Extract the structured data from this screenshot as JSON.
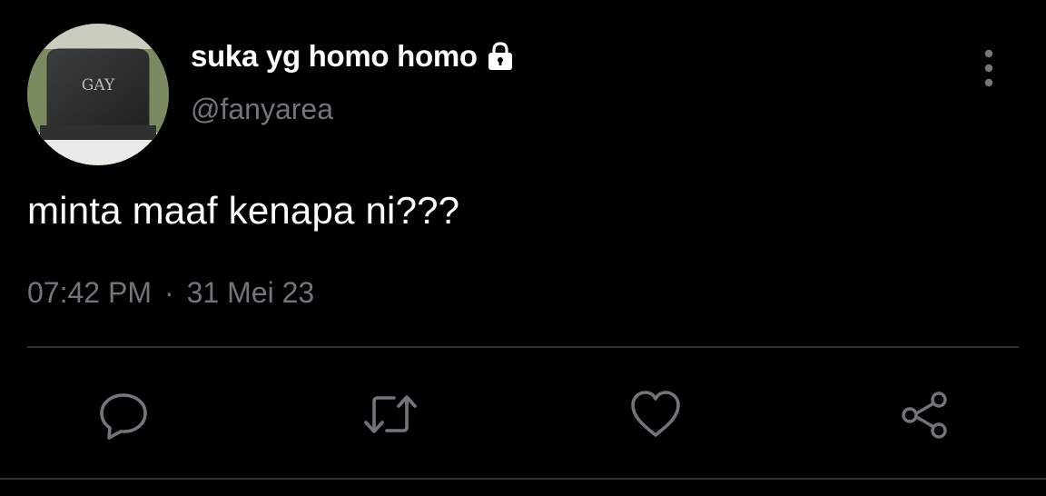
{
  "tweet": {
    "display_name": "suka yg homo homo",
    "handle": "@fanyarea",
    "protected_icon": "lock-icon",
    "avatar": {
      "description_icon": "gravestone-avatar",
      "engraving": "GAY"
    },
    "text": "minta maaf kenapa ni???",
    "time": "07:42 PM",
    "separator": "·",
    "date": "31 Mei 23"
  },
  "actions": [
    {
      "name": "reply",
      "icon": "reply-icon"
    },
    {
      "name": "retweet",
      "icon": "retweet-icon"
    },
    {
      "name": "like",
      "icon": "heart-icon"
    },
    {
      "name": "share",
      "icon": "share-icon"
    }
  ],
  "colors": {
    "background": "#000000",
    "primary_text": "#ffffff",
    "secondary_text": "#71767b",
    "divider": "#2f3336"
  }
}
